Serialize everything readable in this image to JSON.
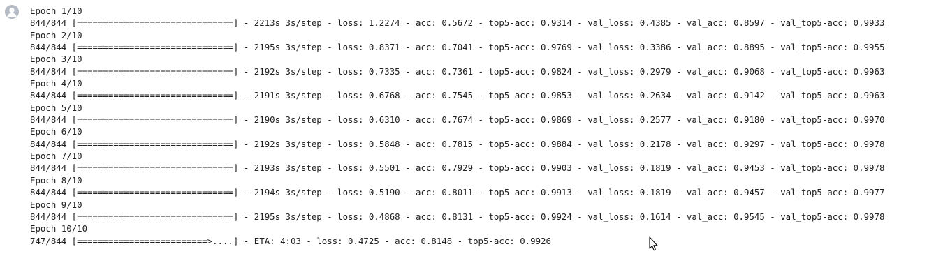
{
  "output": {
    "lines": [
      "Epoch 1/10",
      "844/844 [==============================] - 2213s 3s/step - loss: 1.2274 - acc: 0.5672 - top5-acc: 0.9314 - val_loss: 0.4385 - val_acc: 0.8597 - val_top5-acc: 0.9933",
      "Epoch 2/10",
      "844/844 [==============================] - 2195s 3s/step - loss: 0.8371 - acc: 0.7041 - top5-acc: 0.9769 - val_loss: 0.3386 - val_acc: 0.8895 - val_top5-acc: 0.9955",
      "Epoch 3/10",
      "844/844 [==============================] - 2192s 3s/step - loss: 0.7335 - acc: 0.7361 - top5-acc: 0.9824 - val_loss: 0.2979 - val_acc: 0.9068 - val_top5-acc: 0.9963",
      "Epoch 4/10",
      "844/844 [==============================] - 2191s 3s/step - loss: 0.6768 - acc: 0.7545 - top5-acc: 0.9853 - val_loss: 0.2634 - val_acc: 0.9142 - val_top5-acc: 0.9963",
      "Epoch 5/10",
      "844/844 [==============================] - 2190s 3s/step - loss: 0.6310 - acc: 0.7674 - top5-acc: 0.9869 - val_loss: 0.2577 - val_acc: 0.9180 - val_top5-acc: 0.9970",
      "Epoch 6/10",
      "844/844 [==============================] - 2192s 3s/step - loss: 0.5848 - acc: 0.7815 - top5-acc: 0.9884 - val_loss: 0.2178 - val_acc: 0.9297 - val_top5-acc: 0.9978",
      "Epoch 7/10",
      "844/844 [==============================] - 2193s 3s/step - loss: 0.5501 - acc: 0.7929 - top5-acc: 0.9903 - val_loss: 0.1819 - val_acc: 0.9453 - val_top5-acc: 0.9978",
      "Epoch 8/10",
      "844/844 [==============================] - 2194s 3s/step - loss: 0.5190 - acc: 0.8011 - top5-acc: 0.9913 - val_loss: 0.1819 - val_acc: 0.9457 - val_top5-acc: 0.9977",
      "Epoch 9/10",
      "844/844 [==============================] - 2195s 3s/step - loss: 0.4868 - acc: 0.8131 - top5-acc: 0.9924 - val_loss: 0.1614 - val_acc: 0.9545 - val_top5-acc: 0.9978",
      "Epoch 10/10",
      "747/844 [=========================>....] - ETA: 4:03 - loss: 0.4725 - acc: 0.8148 - top5-acc: 0.9926"
    ]
  },
  "icons": {
    "avatar": "user-avatar-icon",
    "cursor": "mouse-pointer-icon"
  },
  "colors": {
    "text": "#212121",
    "avatar": "#b5bcc6",
    "background": "#ffffff"
  }
}
